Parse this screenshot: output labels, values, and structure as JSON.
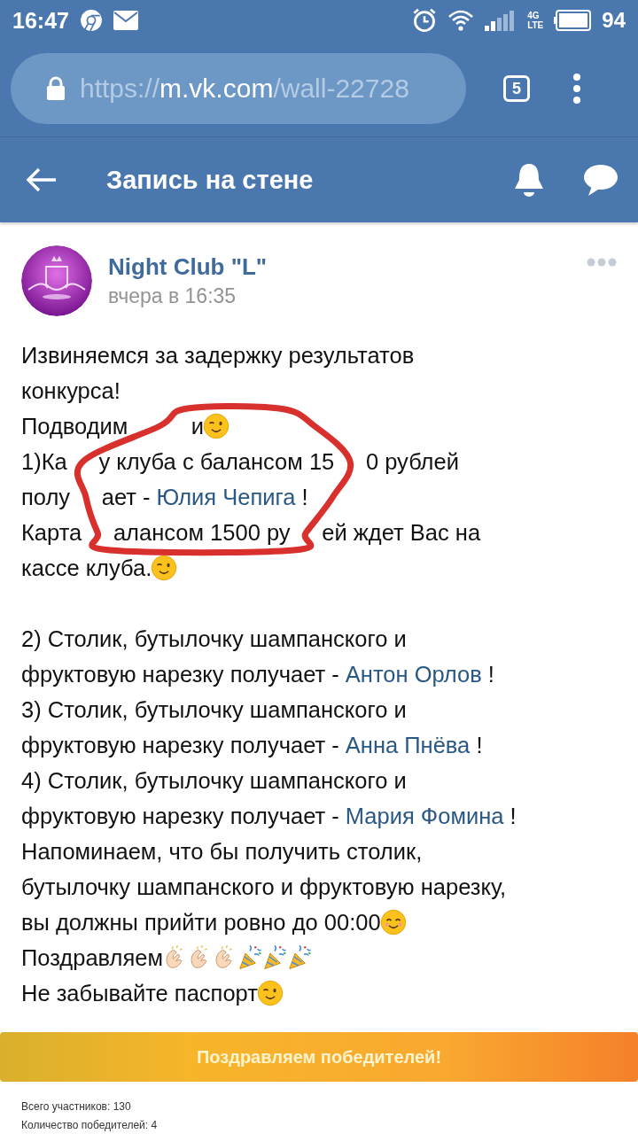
{
  "status_bar": {
    "time": "16:47",
    "network": "4G",
    "network_sub": "LTE",
    "battery": "94"
  },
  "browser": {
    "url_scheme": "https://",
    "url_host": "m.vk.com",
    "url_path": "/wall-22728",
    "tab_count": "5"
  },
  "header": {
    "title": "Запись на стене"
  },
  "post": {
    "author": "Night Club \"L\"",
    "time": "вчера в 16:35",
    "paragraphs": [
      [
        [
          {
            "kind": "text",
            "text": "Извиняемся за задержку результатов"
          }
        ],
        [
          {
            "kind": "text",
            "text": "конкурса!"
          }
        ],
        [
          {
            "kind": "text",
            "text": "Подводим"
          },
          {
            "kind": "covered"
          },
          {
            "kind": "covered"
          },
          {
            "kind": "text",
            "text": "и"
          },
          {
            "kind": "wink"
          }
        ],
        [
          {
            "kind": "text",
            "text": "1)Ка"
          },
          {
            "kind": "covered"
          },
          {
            "kind": "text",
            "text": "у клуба с балансом 15"
          },
          {
            "kind": "covered"
          },
          {
            "kind": "text",
            "text": "0 рублей"
          }
        ],
        [
          {
            "kind": "text",
            "text": "полу"
          },
          {
            "kind": "covered"
          },
          {
            "kind": "text",
            "text": "ает - "
          },
          {
            "kind": "link",
            "text": "Юлия Чепига"
          },
          {
            "kind": "text",
            "text": " !"
          }
        ],
        [
          {
            "kind": "text",
            "text": "Карта"
          },
          {
            "kind": "covered"
          },
          {
            "kind": "text",
            "text": "алансом 1500 ру"
          },
          {
            "kind": "covered"
          },
          {
            "kind": "text",
            "text": "ей ждет Вас на"
          }
        ],
        [
          {
            "kind": "text",
            "text": "кассе клуба."
          },
          {
            "kind": "wink"
          }
        ]
      ],
      [
        [
          {
            "kind": "text",
            "text": "2) Столик, бутылочку шампанского и"
          }
        ],
        [
          {
            "kind": "text",
            "text": "фруктовую нарезку получает - "
          },
          {
            "kind": "link",
            "text": "Антон Орлов"
          },
          {
            "kind": "text",
            "text": " !"
          }
        ],
        [
          {
            "kind": "text",
            "text": "3) Столик, бутылочку шампанского и"
          }
        ],
        [
          {
            "kind": "text",
            "text": "фруктовую нарезку получает - "
          },
          {
            "kind": "link",
            "text": "Анна Пнёва"
          },
          {
            "kind": "text",
            "text": " !"
          }
        ],
        [
          {
            "kind": "text",
            "text": "4) Столик, бутылочку шампанского и"
          }
        ],
        [
          {
            "kind": "text",
            "text": "фруктовую нарезку получает - "
          },
          {
            "kind": "link",
            "text": "Мария Фомина"
          },
          {
            "kind": "text",
            "text": " !"
          }
        ],
        [
          {
            "kind": "text",
            "text": "Напоминаем, что бы получить столик,"
          }
        ],
        [
          {
            "kind": "text",
            "text": "бутылочку шампанского и фруктовую нарезку,"
          }
        ],
        [
          {
            "kind": "text",
            "text": "вы должны прийти ровно до 00:00"
          },
          {
            "kind": "smile"
          }
        ],
        [
          {
            "kind": "text",
            "text": "Поздравляем"
          },
          {
            "kind": "clap"
          },
          {
            "kind": "clap"
          },
          {
            "kind": "clap"
          },
          {
            "kind": "party"
          },
          {
            "kind": "party"
          },
          {
            "kind": "party"
          }
        ],
        [
          {
            "kind": "text",
            "text": "Не забывайте паспорт"
          },
          {
            "kind": "wink"
          }
        ]
      ]
    ],
    "attachment": {
      "banner": "Поздравляем победителей!",
      "lines": [
        "Всего участников: 130",
        "Количество победителей: 4"
      ]
    }
  }
}
